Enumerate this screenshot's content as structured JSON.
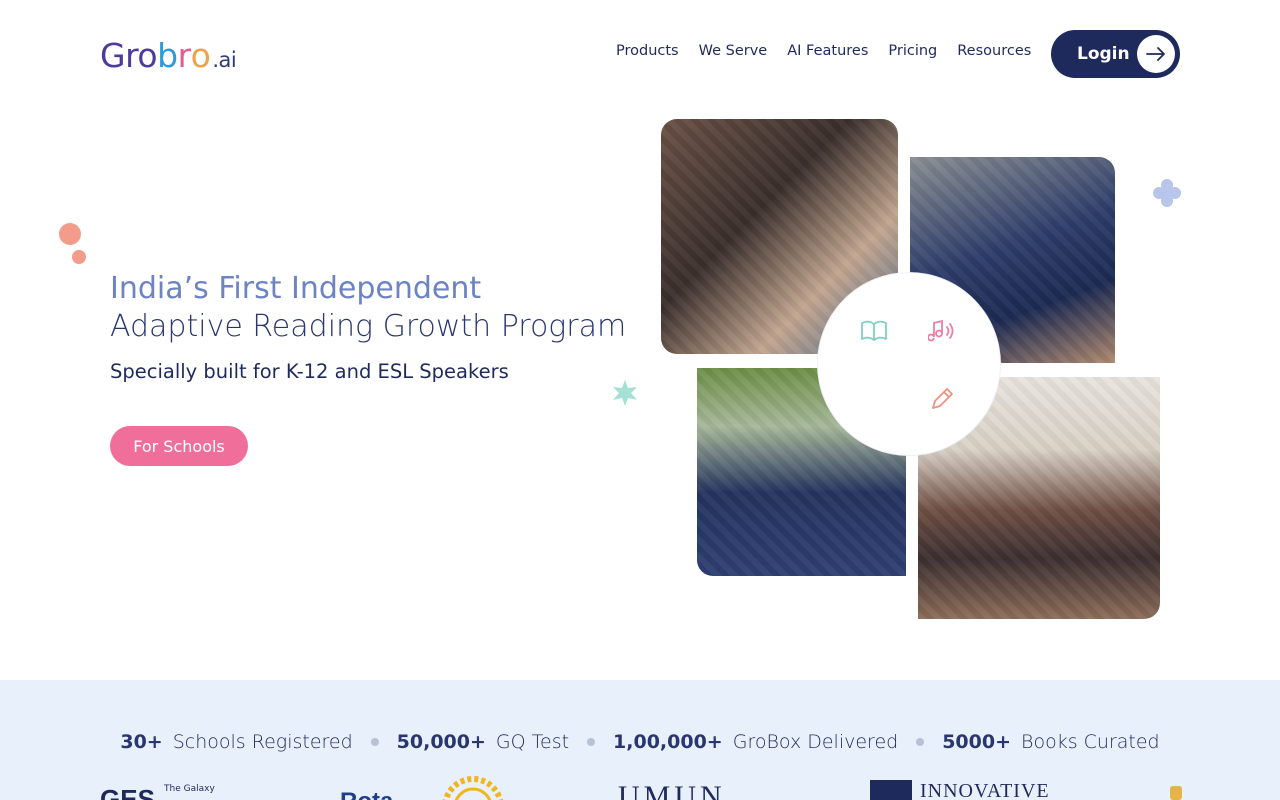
{
  "header": {
    "logo": {
      "part1": "Gro",
      "part2": "b",
      "part3": "r",
      "part4": "o",
      "suffix": ".ai"
    },
    "nav": [
      "Products",
      "We Serve",
      "AI Features",
      "Pricing",
      "Resources"
    ],
    "login_label": "Login"
  },
  "hero": {
    "title_line1": "India’s First Independent",
    "title_line2": "Adaptive Reading Growth Program",
    "subtitle": "Specially built for K-12 and ESL Speakers",
    "cta_label": "For Schools"
  },
  "stats": [
    {
      "number": "30+",
      "label": "Schools Registered"
    },
    {
      "number": "50,000+",
      "label": "GQ Test"
    },
    {
      "number": "1,00,000+",
      "label": "GroBox Delivered"
    },
    {
      "number": "5000+",
      "label": "Books Curated"
    }
  ],
  "partners": {
    "p1": "GES",
    "p1_sub": "The Galaxy",
    "p2": "Rota",
    "p3": "UMUN",
    "p4": "INNOVATIVE"
  },
  "colors": {
    "navy": "#1f2a5c",
    "pink": "#ef6f9a",
    "band": "#e8f0fb",
    "title_blue": "#6c83c4"
  },
  "icons": [
    "book-icon",
    "music-note-icon",
    "pencil-icon",
    "arrow-right-icon"
  ]
}
